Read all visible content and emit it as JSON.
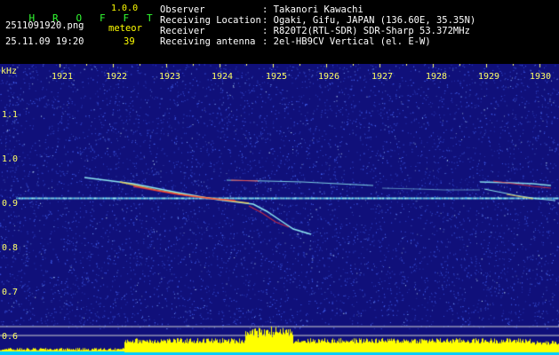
{
  "header": {
    "brand_letters": [
      "H",
      "R",
      "O",
      "F",
      "F",
      "T"
    ],
    "version": "1.0.0",
    "filename": "2511091920.png",
    "datetime": "25.11.09 19:20",
    "meteor_label": "meteor",
    "meteor_count": "39",
    "info": [
      {
        "key": "Observer",
        "value": ": Takanori Kawachi"
      },
      {
        "key": "Receiving Location",
        "value": ": Ogaki, Gifu, JAPAN (136.60E, 35.35N)"
      },
      {
        "key": "Receiver",
        "value": ": R820T2(RTL-SDR) SDR-Sharp 53.372MHz"
      },
      {
        "key": "Receiving antenna",
        "value": ": 2el-HB9CV Vertical (el. E-W)"
      }
    ]
  },
  "spectrogram": {
    "unit_label": "kHz",
    "time_ticks": [
      "1921",
      "1922",
      "1923",
      "1924",
      "1925",
      "1926",
      "1927",
      "1928",
      "1929",
      "1930"
    ],
    "freq_ticks": [
      "1.1",
      "1.0",
      "0.9",
      "0.8",
      "0.7",
      "0.6"
    ],
    "freq_range": [
      0.58,
      1.2
    ],
    "carrier_khz": 0.915,
    "colors": {
      "background": "#10107a",
      "noise": "#4a6cff",
      "trace": "#9bffff",
      "hot": "#ff3030",
      "power_fill": "#ffff00",
      "baseline": "#00ccff",
      "tick": "#ffff66"
    }
  }
}
